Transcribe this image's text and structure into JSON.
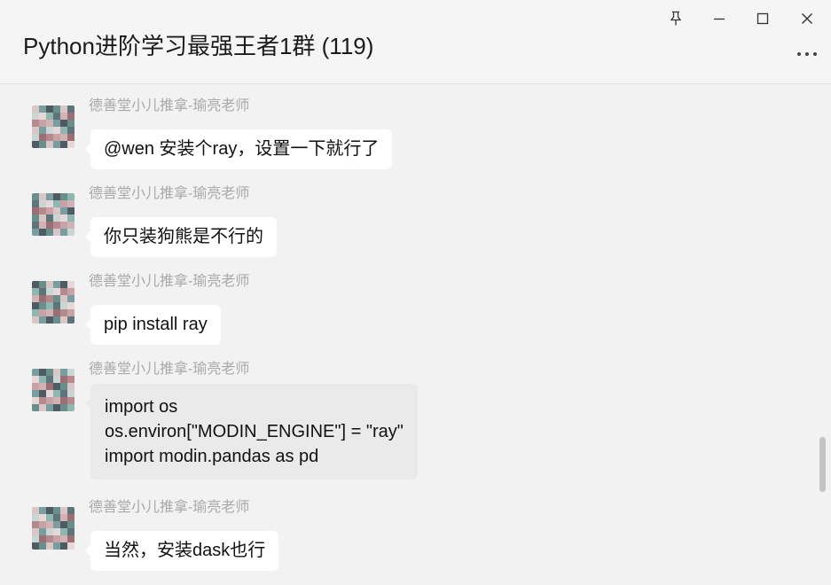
{
  "window": {
    "title": "Python进阶学习最强王者1群 (119)",
    "controls": [
      "pin-icon",
      "minimize-icon",
      "maximize-icon",
      "close-icon"
    ],
    "more_icon": "more-horizontal-icon"
  },
  "messages": [
    {
      "sender": "德善堂小儿推拿-瑜亮老师",
      "text": "@wen 安装个ray，设置一下就行了"
    },
    {
      "sender": "德善堂小儿推拿-瑜亮老师",
      "text": "你只装狗熊是不行的"
    },
    {
      "sender": "德善堂小儿推拿-瑜亮老师",
      "text": "pip install ray"
    },
    {
      "sender": "德善堂小儿推拿-瑜亮老师",
      "text": "import os\nos.environ[\"MODIN_ENGINE\"] = \"ray\"\nimport modin.pandas as pd"
    },
    {
      "sender": "德善堂小儿推拿-瑜亮老师",
      "text": "当然，安装dask也行"
    }
  ],
  "colors": {
    "background": "#f2f2f2",
    "bubble": "#ffffff",
    "code_bubble": "#eaeaea",
    "sender_text": "#a9a9a9",
    "scroll_thumb": "#c4c4c4"
  }
}
